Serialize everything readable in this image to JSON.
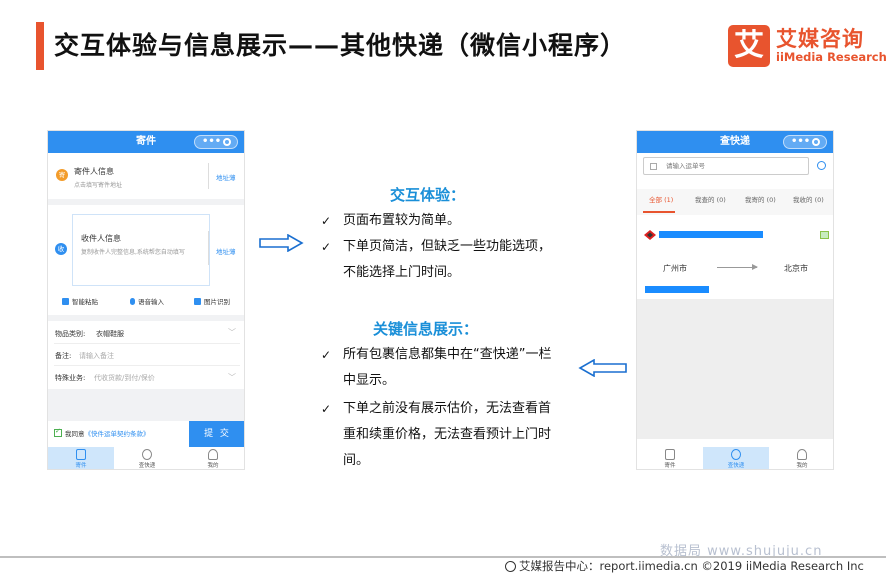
{
  "title": "交互体验与信息展示——其他快递（微信小程序）",
  "logo": {
    "mark": "艾",
    "cn": "艾媒咨询",
    "en": "iiMedia Research"
  },
  "left_phone": {
    "header": "寄件",
    "sender": {
      "badge": "寄",
      "title": "寄件人信息",
      "sub": "点击填写寄件地址",
      "link": "地址薄"
    },
    "receiver": {
      "badge": "收",
      "title": "收件人信息",
      "sub": "复制收件人完整信息,系统帮您自动填写",
      "link": "地址薄"
    },
    "tools": [
      "智能粘贴",
      "语音输入",
      "图片识别"
    ],
    "fields": [
      {
        "label": "物品类别:",
        "value": "衣帽鞋服"
      },
      {
        "label": "备注:",
        "value": "请输入备注"
      },
      {
        "label": "特殊业务:",
        "value": "代收货款/到付/保价"
      }
    ],
    "agree_prefix": "我同意",
    "agree_link": "《快件运单契约条款》",
    "submit": "提 交",
    "tabs": [
      "寄件",
      "查快递",
      "我的"
    ]
  },
  "right_phone": {
    "header": "查快递",
    "search_placeholder": "请输入运单号",
    "tabs": [
      "全部 (1)",
      "我查的 (0)",
      "我寄的 (0)",
      "我收的 (0)"
    ],
    "from_city": "广州市",
    "to_city": "北京市",
    "bottom_tabs": [
      "寄件",
      "查快递",
      "我的"
    ]
  },
  "interaction": {
    "title": "交互体验：",
    "bullets": [
      "页面布置较为简单。",
      "下单页简洁，但缺乏一些功能选项，不能选择上门时间。"
    ]
  },
  "key_info": {
    "title": "关键信息展示：",
    "bullets": [
      "所有包裹信息都集中在“查快递”一栏中显示。",
      "下单之前没有展示估价，无法查看首重和续重价格，无法查看预计上门时间。"
    ]
  },
  "watermark": "数据局 www.shujuju.cn",
  "footer": "艾媒报告中心：report.iimedia.cn ©2019 iiMedia Research Inc",
  "colors": {
    "accent": "#e8542e",
    "blue": "#2f8ff0",
    "section_title": "#1a8fd8"
  }
}
